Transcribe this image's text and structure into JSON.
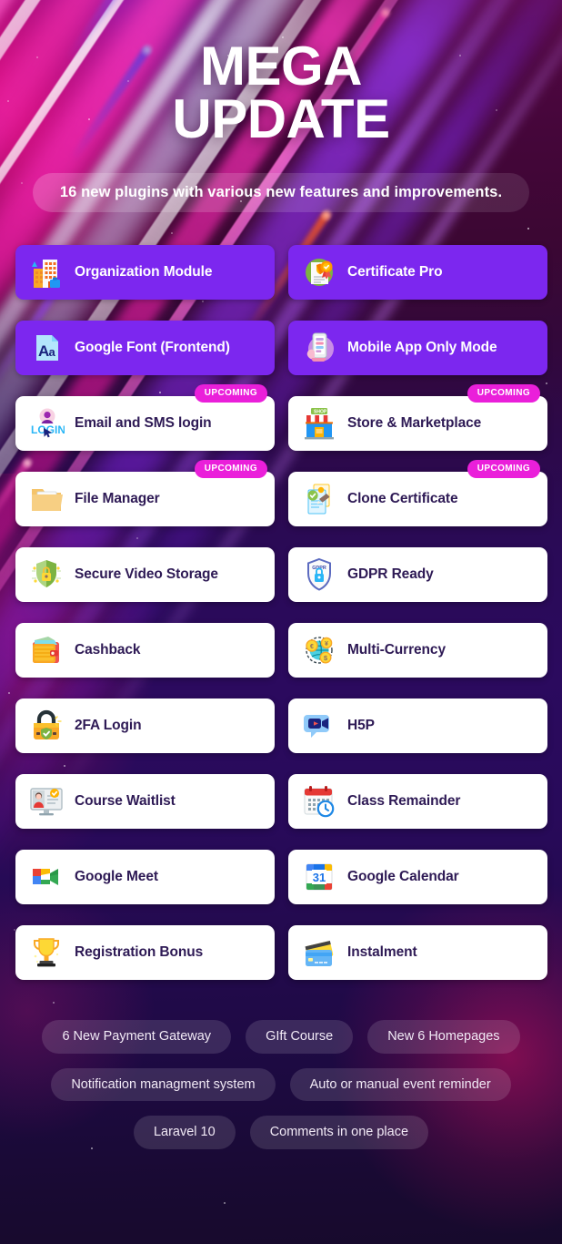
{
  "hero": {
    "title_line1": "MEGA",
    "title_line2": "UPDATE",
    "subtitle": "16 new plugins with various new features and improvements."
  },
  "colors": {
    "card_purple": "#7c27ef",
    "card_white": "#ffffff",
    "badge_magenta": "#ea1fda",
    "white_card_text": "#2e1a55",
    "bg_top": "#5e0a4a",
    "bg_bottom": "#170a2c"
  },
  "badge_label": "UPCOMING",
  "features": [
    {
      "label": "Organization Module",
      "style": "purple",
      "icon": "office-building-icon",
      "badge": null
    },
    {
      "label": "Certificate Pro",
      "style": "purple",
      "icon": "certificate-award-icon",
      "badge": null
    },
    {
      "label": "Google Font (Frontend)",
      "style": "purple",
      "icon": "font-aa-icon",
      "badge": null
    },
    {
      "label": "Mobile App Only Mode",
      "style": "purple",
      "icon": "mobile-phone-hand-icon",
      "badge": null
    },
    {
      "label": "Email and SMS login",
      "style": "white",
      "icon": "login-user-cursor-icon",
      "badge": "UPCOMING"
    },
    {
      "label": "Store & Marketplace",
      "style": "white",
      "icon": "shop-storefront-icon",
      "badge": "UPCOMING"
    },
    {
      "label": "File Manager",
      "style": "white",
      "icon": "folder-documents-icon",
      "badge": "UPCOMING"
    },
    {
      "label": "Clone Certificate",
      "style": "white",
      "icon": "clone-certificate-icon",
      "badge": "UPCOMING"
    },
    {
      "label": "Secure Video Storage",
      "style": "white",
      "icon": "shield-lock-green-icon",
      "badge": null
    },
    {
      "label": "GDPR Ready",
      "style": "white",
      "icon": "gdpr-shield-icon",
      "badge": null
    },
    {
      "label": "Cashback",
      "style": "white",
      "icon": "wallet-money-icon",
      "badge": null
    },
    {
      "label": "Multi-Currency",
      "style": "white",
      "icon": "globe-coins-icon",
      "badge": null
    },
    {
      "label": "2FA Login",
      "style": "white",
      "icon": "padlock-shield-icon",
      "badge": null
    },
    {
      "label": "H5P",
      "style": "white",
      "icon": "video-bubble-icon",
      "badge": null
    },
    {
      "label": "Course Waitlist",
      "style": "white",
      "icon": "monitor-person-icon",
      "badge": null
    },
    {
      "label": "Class Remainder",
      "style": "white",
      "icon": "calendar-clock-icon",
      "badge": null
    },
    {
      "label": "Google Meet",
      "style": "white",
      "icon": "google-meet-icon",
      "badge": null
    },
    {
      "label": "Google Calendar",
      "style": "white",
      "icon": "google-calendar-icon",
      "badge": null
    },
    {
      "label": "Registration Bonus",
      "style": "white",
      "icon": "trophy-icon",
      "badge": null
    },
    {
      "label": "Instalment",
      "style": "white",
      "icon": "credit-cards-icon",
      "badge": null
    }
  ],
  "tag_rows": [
    [
      "6 New Payment Gateway",
      "GIft Course",
      "New 6 Homepages"
    ],
    [
      "Notification managment system",
      "Auto or manual event reminder"
    ],
    [
      "Laravel 10",
      "Comments in one place"
    ]
  ]
}
